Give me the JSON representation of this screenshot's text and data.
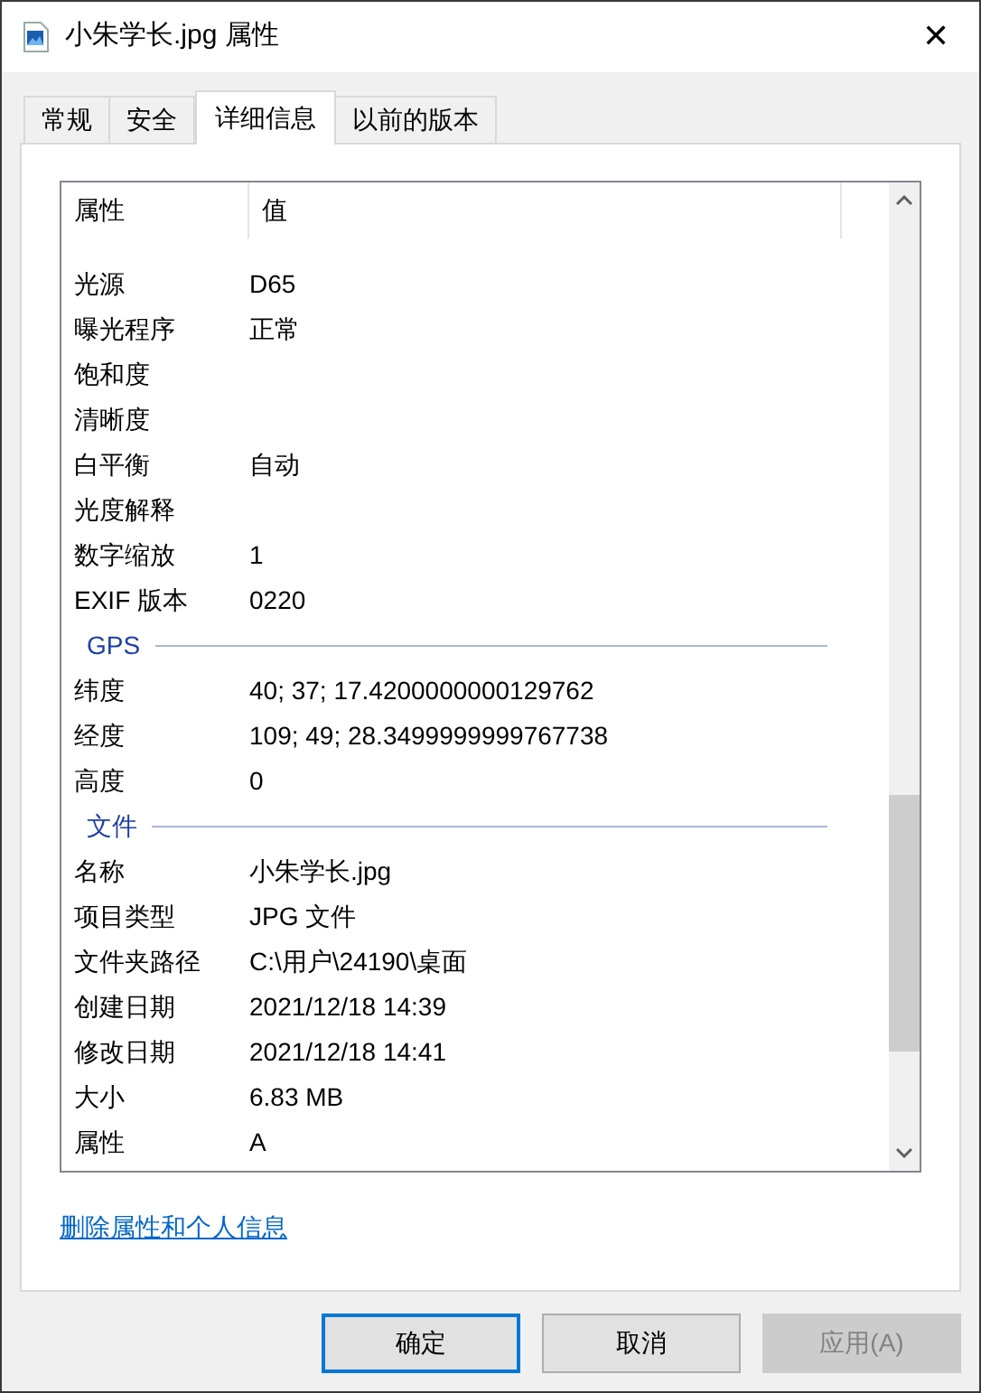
{
  "window": {
    "title": "小朱学长.jpg 属性",
    "close": "✕"
  },
  "tabs": [
    {
      "label": "常规",
      "selected": false
    },
    {
      "label": "安全",
      "selected": false
    },
    {
      "label": "详细信息",
      "selected": true
    },
    {
      "label": "以前的版本",
      "selected": false
    }
  ],
  "list": {
    "columns": [
      "属性",
      "值"
    ],
    "rows": [
      {
        "kind": "row",
        "name": "光源",
        "value": "D65"
      },
      {
        "kind": "row",
        "name": "曝光程序",
        "value": "正常"
      },
      {
        "kind": "row",
        "name": "饱和度",
        "value": ""
      },
      {
        "kind": "row",
        "name": "清晰度",
        "value": ""
      },
      {
        "kind": "row",
        "name": "白平衡",
        "value": "自动"
      },
      {
        "kind": "row",
        "name": "光度解释",
        "value": ""
      },
      {
        "kind": "row",
        "name": "数字缩放",
        "value": "1"
      },
      {
        "kind": "row",
        "name": "EXIF 版本",
        "value": "0220"
      },
      {
        "kind": "group",
        "name": "GPS"
      },
      {
        "kind": "row",
        "name": "纬度",
        "value": "40; 37; 17.4200000000129762"
      },
      {
        "kind": "row",
        "name": "经度",
        "value": "109; 49; 28.3499999999767738"
      },
      {
        "kind": "row",
        "name": "高度",
        "value": "0"
      },
      {
        "kind": "group",
        "name": "文件"
      },
      {
        "kind": "row",
        "name": "名称",
        "value": "小朱学长.jpg"
      },
      {
        "kind": "row",
        "name": "项目类型",
        "value": "JPG 文件"
      },
      {
        "kind": "row",
        "name": "文件夹路径",
        "value": "C:\\用户\\24190\\桌面"
      },
      {
        "kind": "row",
        "name": "创建日期",
        "value": "2021/12/18 14:39"
      },
      {
        "kind": "row",
        "name": "修改日期",
        "value": "2021/12/18 14:41"
      },
      {
        "kind": "row",
        "name": "大小",
        "value": "6.83 MB"
      },
      {
        "kind": "row",
        "name": "属性",
        "value": "A"
      }
    ]
  },
  "link": "删除属性和个人信息",
  "buttons": [
    {
      "label": "确定",
      "default": true,
      "disabled": false
    },
    {
      "label": "取消",
      "default": false,
      "disabled": false
    },
    {
      "label": "应用(A)",
      "default": false,
      "disabled": true
    }
  ]
}
